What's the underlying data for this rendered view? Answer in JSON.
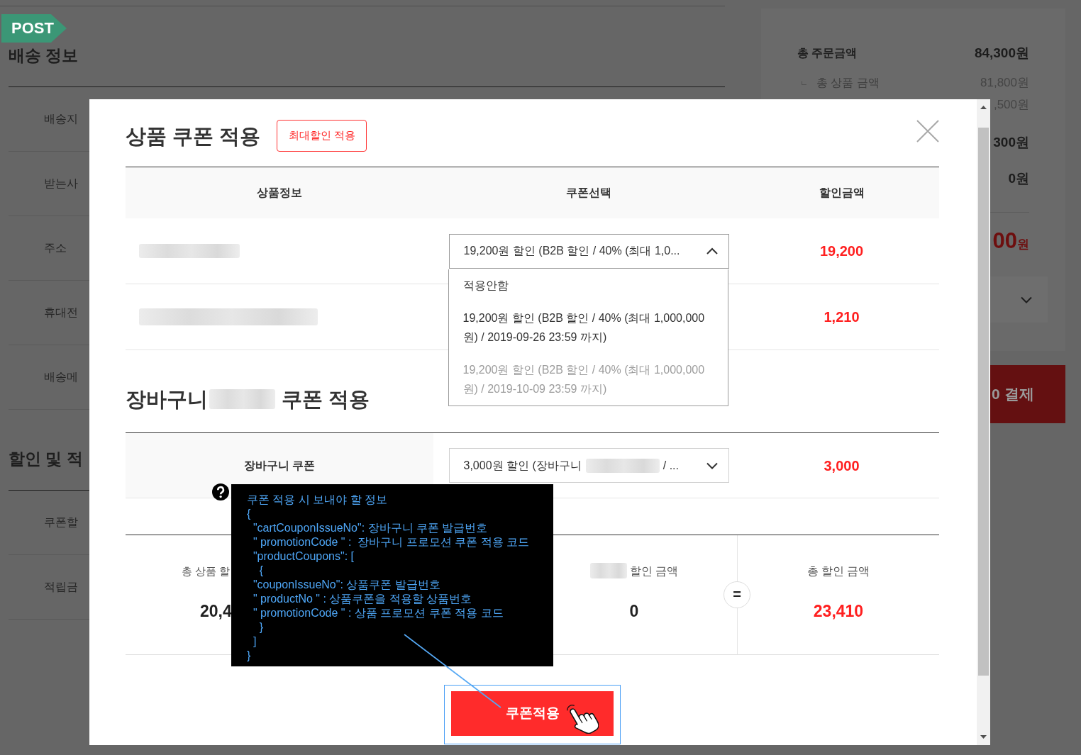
{
  "post_tag": "POST",
  "page": {
    "sections": [
      {
        "title": "배송 정보",
        "rows": [
          "배송지",
          "받는사",
          "주소",
          "휴대전",
          "배송메"
        ]
      },
      {
        "title": "할인 및 적",
        "rows": [
          "쿠폰할",
          "적립금"
        ]
      }
    ],
    "summary": [
      {
        "kind": "total",
        "label": "총 주문금액",
        "value": "84,300원"
      },
      {
        "kind": "sub",
        "prefix": "ㄴ",
        "label": "총 상품 금액",
        "value": "81,800원"
      },
      {
        "kind": "sub",
        "value": ",500원"
      },
      {
        "kind": "total",
        "value": "300원"
      },
      {
        "kind": "total",
        "value": "0원"
      },
      {
        "kind": "final",
        "value": "00",
        "unit": "원"
      }
    ],
    "pay_button": "0 결제"
  },
  "modal": {
    "title": "상품 쿠폰 적용",
    "max_discount_button": "최대할인 적용",
    "columns": [
      "상품정보",
      "쿠폰선택",
      "할인금액"
    ],
    "rows": [
      {
        "coupon": {
          "value": "19,200원 할인 (B2B 할인 / 40% (최대 1,0...",
          "expanded": true,
          "options": [
            {
              "label": "적용안함",
              "disabled": false
            },
            {
              "label": "19,200원 할인 (B2B 할인 / 40% (최대 1,000,000원) / 2019-09-26 23:59 까지)",
              "disabled": false
            },
            {
              "label": "19,200원 할인 (B2B 할인 / 40% (최대 1,000,000원) / 2019-10-09 23:59 까지)",
              "disabled": true
            }
          ]
        },
        "discount": "19,200"
      },
      {
        "discount": "1,210"
      }
    ],
    "cart": {
      "title_start": "장바구니",
      "title_end": "쿠폰 적용",
      "label": "장바구니 쿠폰",
      "coupon": {
        "value": "3,000원 할인 (장바구니",
        "value_end": "/ ...",
        "expanded": false
      },
      "discount": "3,000"
    },
    "totals": [
      {
        "kind": "plain",
        "label": "총 상품 할",
        "value": "20,4",
        "highlighted": false
      },
      {
        "kind": "redacted",
        "label": "할인 금액",
        "value": "0",
        "highlighted": false
      },
      {
        "kind": "plain",
        "operator": "=",
        "label": "총 할인 금액",
        "value": "23,410",
        "highlighted": true
      }
    ],
    "apply_button": "쿠폰적용",
    "tooltip": {
      "lines": [
        "쿠폰 적용 시 보내야 할 정보",
        "{",
        "  \"cartCouponIssueNo\": 장바구니 쿠폰 발급번호",
        "  \" promotionCode \" :  장바구니 프로모션 쿠폰 적용 코드",
        "  \"productCoupons\": [",
        "    {",
        "  \"couponIssueNo\": 상품쿠폰 발급번호",
        "  \" productNo \" : 상품쿠폰을 적용할 상품번호",
        "  \" promotionCode \" : 상품 프로모션 쿠폰 적용 코드",
        "    }",
        "  ]",
        "}"
      ]
    }
  }
}
